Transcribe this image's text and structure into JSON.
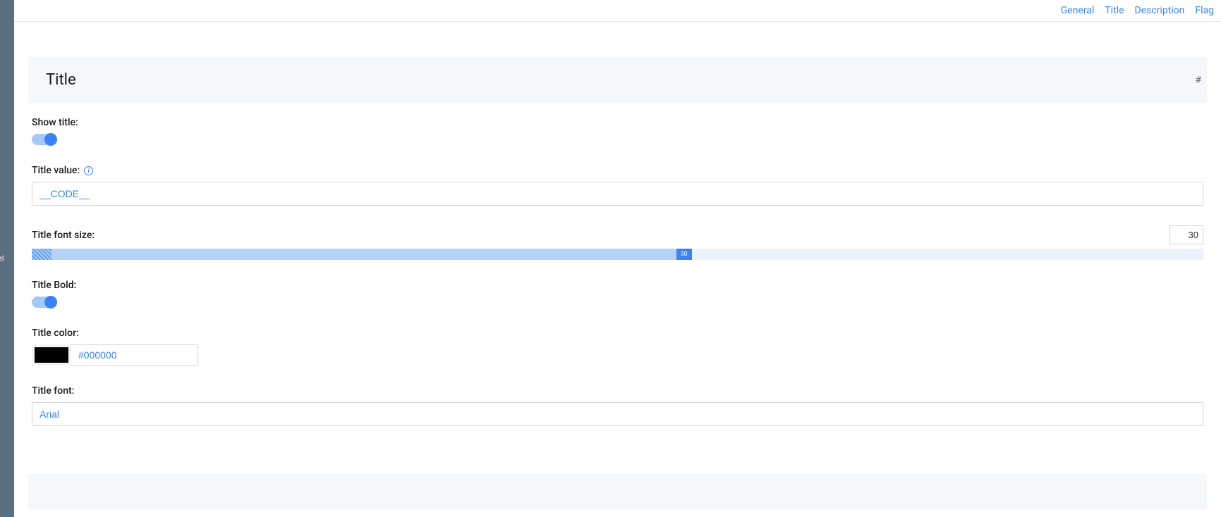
{
  "nav": {
    "general": "General",
    "title": "Title",
    "description": "Description",
    "flag": "Flag"
  },
  "sidebar": {
    "fragment": "el"
  },
  "section": {
    "title": "Title"
  },
  "form": {
    "show_title_label": "Show title:",
    "show_title_on": true,
    "title_value_label": "Title value:",
    "title_value": "__CODE__",
    "font_size_label": "Title font size:",
    "font_size_value": "30",
    "slider_label": "30",
    "slider_fill_percent": 55,
    "title_bold_label": "Title Bold:",
    "title_bold_on": true,
    "title_color_label": "Title color:",
    "title_color_hex": "#000000",
    "title_color_swatch": "#000000",
    "title_font_label": "Title font:",
    "title_font_value": "Arial"
  }
}
